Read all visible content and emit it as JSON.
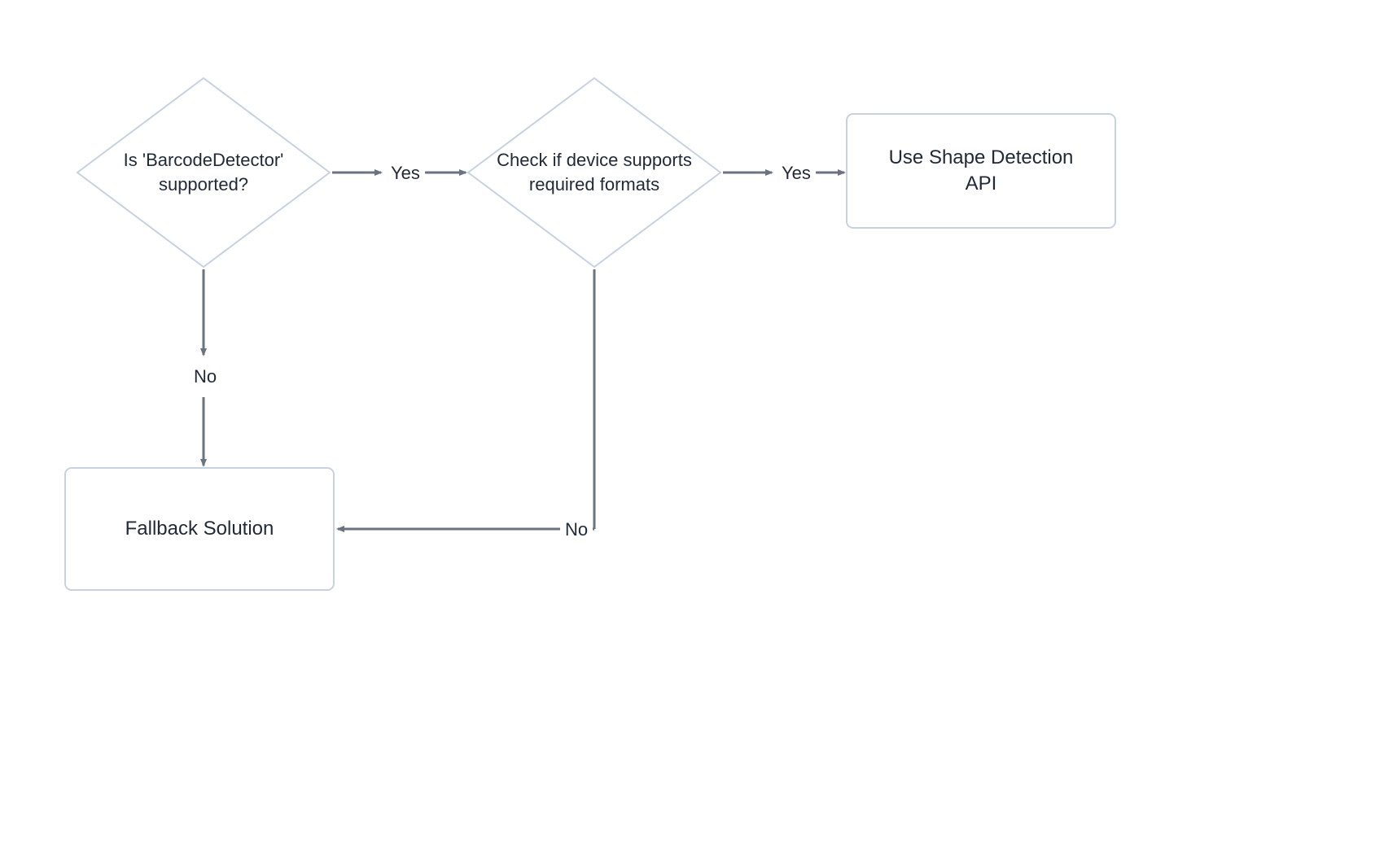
{
  "nodes": {
    "decision1": {
      "line1": "Is 'BarcodeDetector'",
      "line2": "supported?"
    },
    "decision2": {
      "line1": "Check if device supports",
      "line2": "required formats"
    },
    "process_fallback": "Fallback Solution",
    "process_api": {
      "line1": "Use Shape Detection",
      "line2": "API"
    }
  },
  "edges": {
    "yes1": "Yes",
    "yes2": "Yes",
    "no1": "No",
    "no2": "No"
  },
  "colors": {
    "stroke_shape": "#c7d2e0",
    "stroke_arrow": "#6b7280",
    "text": "#1f2937"
  }
}
